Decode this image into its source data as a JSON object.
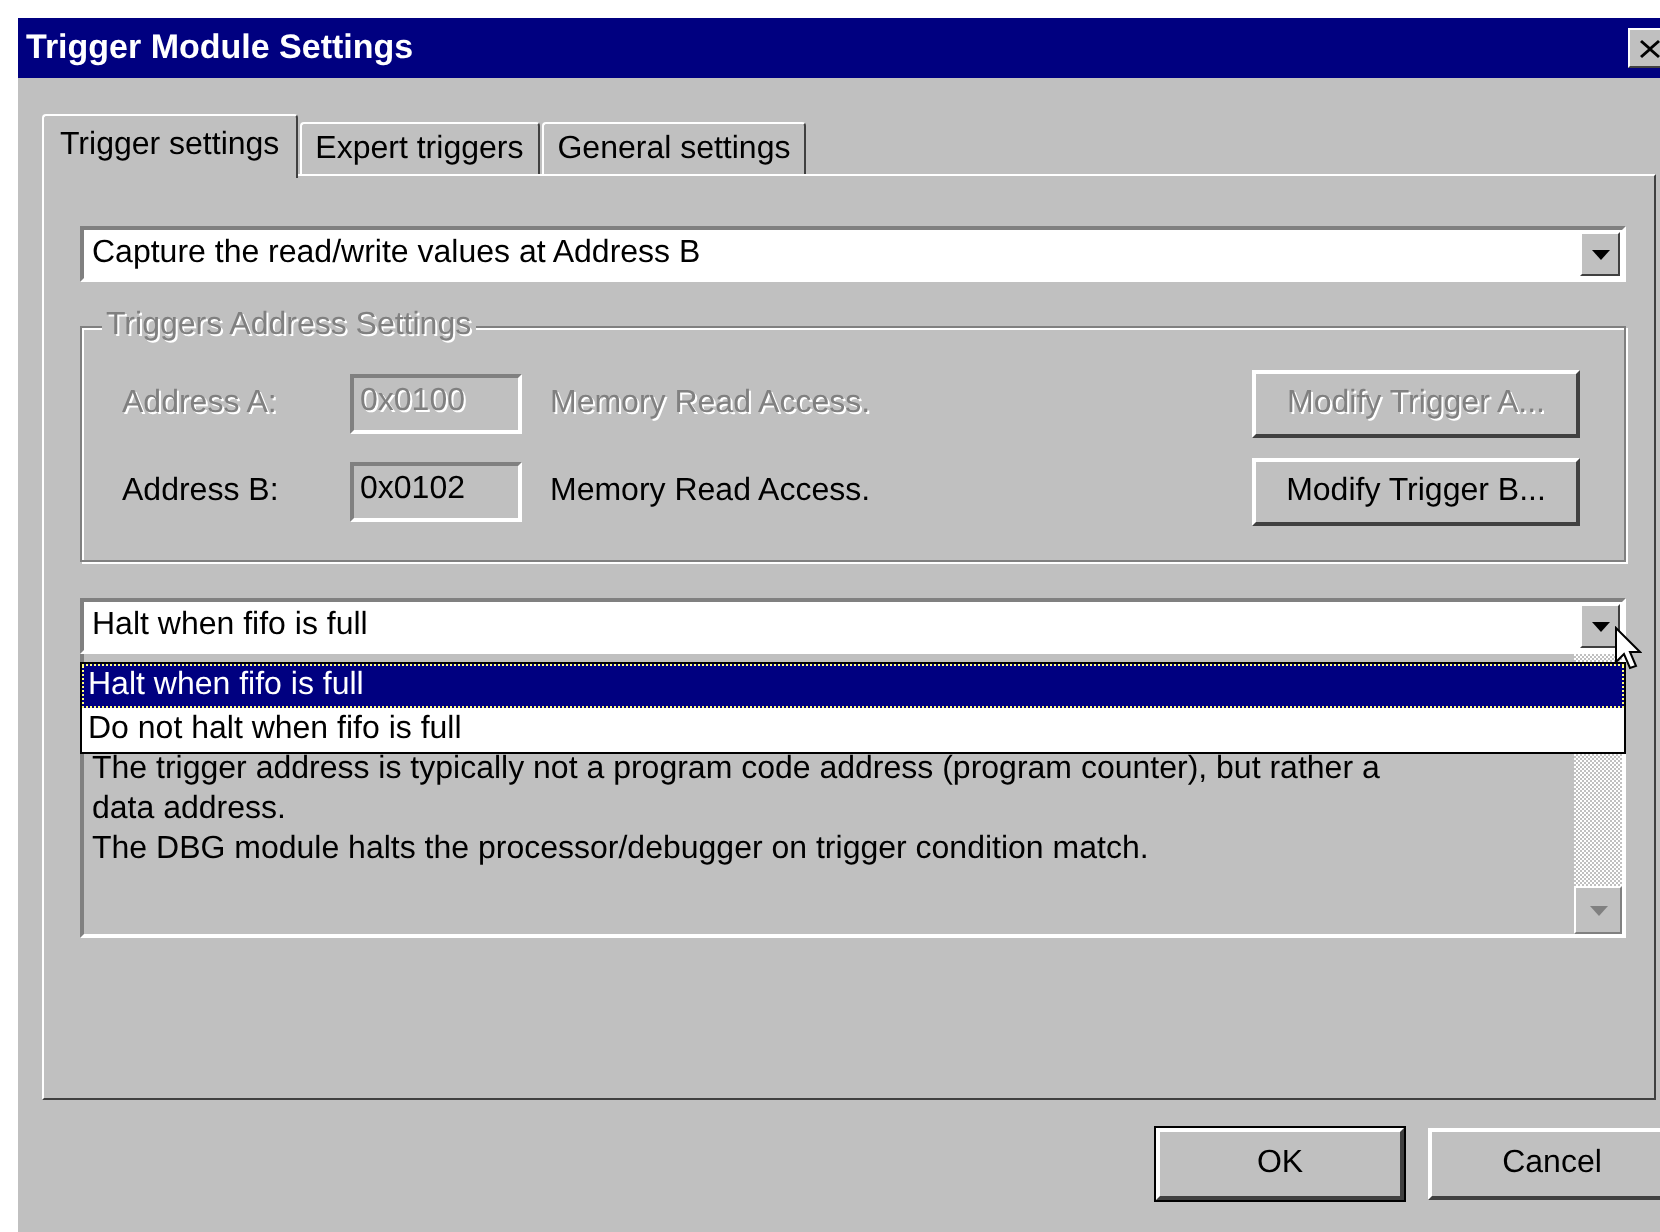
{
  "window": {
    "title": "Trigger Module Settings"
  },
  "tabs": [
    {
      "label": "Trigger settings",
      "selected": true
    },
    {
      "label": "Expert triggers",
      "selected": false
    },
    {
      "label": "General settings",
      "selected": false
    }
  ],
  "capture_mode": {
    "value": "Capture the read/write values at Address B"
  },
  "address_group": {
    "title": "Triggers Address Settings",
    "disabled": true,
    "rows": [
      {
        "label": "Address A:",
        "value": "0x0100",
        "access": "Memory Read Access.",
        "button": "Modify Trigger A...",
        "disabled": true
      },
      {
        "label": "Address B:",
        "value": "0x0102",
        "access": "Memory Read Access.",
        "button": "Modify Trigger B...",
        "disabled": false
      }
    ]
  },
  "halt_mode": {
    "value": "Halt when fifo is full",
    "expanded": true,
    "options": [
      {
        "label": "Halt when fifo is full",
        "selected": true
      },
      {
        "label": "Do not halt when fifo is full",
        "selected": false
      }
    ]
  },
  "description": {
    "lines": [
      "The trigger address is typically not a program code address (program counter), but rather a",
      "data address.",
      "The DBG module halts the processor/debugger on trigger condition match."
    ]
  },
  "buttons": [
    {
      "label": "OK",
      "default": true
    },
    {
      "label": "Cancel",
      "default": false
    }
  ]
}
